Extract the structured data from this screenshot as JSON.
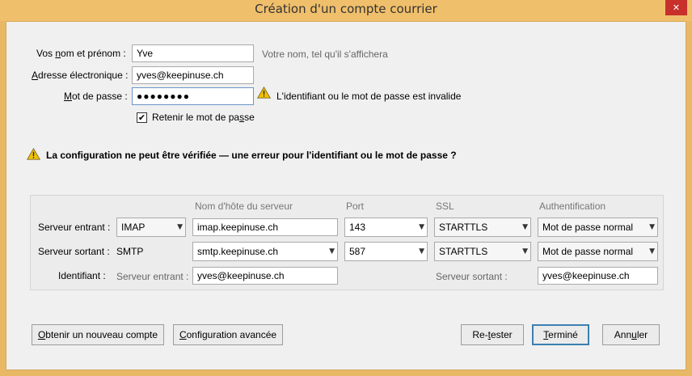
{
  "window": {
    "title": "Création d'un compte courrier",
    "close_glyph": "✕"
  },
  "form": {
    "name_label_pre": "Vos ",
    "name_label_u": "n",
    "name_label_post": "om et prénom :",
    "name_value": "Yve",
    "name_hint": "Votre nom, tel qu'il s'affichera",
    "email_label_u": "A",
    "email_label_post": "dresse électronique :",
    "email_value": "yves@keepinuse.ch",
    "password_label_u": "M",
    "password_label_post": "ot de passe :",
    "password_value": "●●●●●●●●",
    "password_error": "L'identifiant ou le mot de passe est invalide",
    "remember_checked": true,
    "remember_check_glyph": "✔",
    "remember_label_pre": "Retenir le mot de pa",
    "remember_label_u": "s",
    "remember_label_post": "se"
  },
  "warning": {
    "text": "La configuration ne peut être vérifiée — une erreur pour l'identifiant ou le mot de passe ?"
  },
  "server_table": {
    "headers": {
      "hostname": "Nom d'hôte du serveur",
      "port": "Port",
      "ssl": "SSL",
      "auth": "Authentification"
    },
    "incoming": {
      "label": "Serveur entrant :",
      "protocol": "IMAP",
      "hostname": "imap.keepinuse.ch",
      "port": "143",
      "ssl": "STARTTLS",
      "auth": "Mot de passe normal"
    },
    "outgoing": {
      "label": "Serveur sortant :",
      "protocol": "SMTP",
      "hostname": "smtp.keepinuse.ch",
      "port": "587",
      "ssl": "STARTTLS",
      "auth": "Mot de passe normal"
    },
    "identifier": {
      "label": "Identifiant :",
      "incoming_label": "Serveur entrant :",
      "incoming_value": "yves@keepinuse.ch",
      "outgoing_label": "Serveur sortant :",
      "outgoing_value": "yves@keepinuse.ch"
    }
  },
  "buttons": {
    "new_account_u": "O",
    "new_account_post": "btenir un nouveau compte",
    "advanced_u": "C",
    "advanced_post": "onfiguration avancée",
    "retest_pre": "Re-",
    "retest_u": "t",
    "retest_post": "ester",
    "done_u": "T",
    "done_post": "erminé",
    "cancel_pre": "Ann",
    "cancel_u": "u",
    "cancel_post": "ler"
  },
  "icons": {
    "chevron": "▼",
    "warning_color": "#f2c200",
    "close_bg": "#c7302b",
    "titlebar_bg": "#f0bf6b"
  }
}
